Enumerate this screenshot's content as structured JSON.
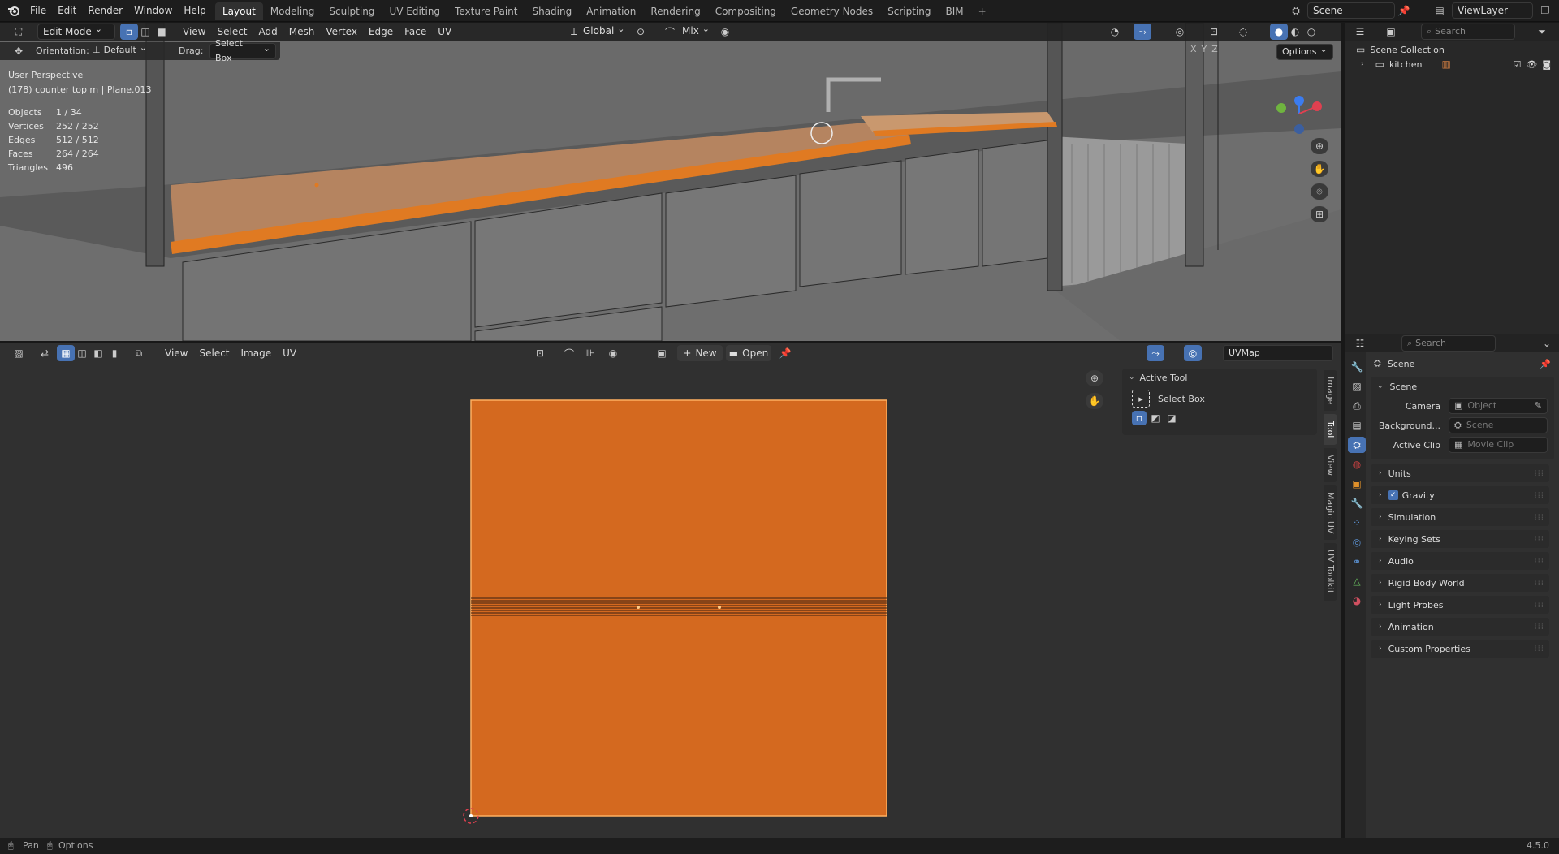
{
  "menu": {
    "file": "File",
    "edit": "Edit",
    "render": "Render",
    "window": "Window",
    "help": "Help"
  },
  "workspaces": [
    "Layout",
    "Modeling",
    "Sculpting",
    "UV Editing",
    "Texture Paint",
    "Shading",
    "Animation",
    "Rendering",
    "Compositing",
    "Geometry Nodes",
    "Scripting",
    "BIM"
  ],
  "active_workspace": "Layout",
  "scene": {
    "name": "Scene",
    "view_layer": "ViewLayer"
  },
  "viewport": {
    "mode": "Edit Mode",
    "menus": [
      "View",
      "Select",
      "Add",
      "Mesh",
      "Vertex",
      "Edge",
      "Face",
      "UV"
    ],
    "transform_orientation": "Global",
    "proportional": "Mix",
    "orientation_label": "Orientation:",
    "orientation_value": "Default",
    "drag_label": "Drag:",
    "drag_value": "Select Box",
    "options": "Options",
    "axes": [
      "X",
      "Y",
      "Z"
    ],
    "view_name": "User Perspective",
    "object_info": "(178) counter top m | Plane.013",
    "stats": [
      {
        "label": "Objects",
        "value": "1 / 34"
      },
      {
        "label": "Vertices",
        "value": "252 / 252"
      },
      {
        "label": "Edges",
        "value": "512 / 512"
      },
      {
        "label": "Faces",
        "value": "264 / 264"
      },
      {
        "label": "Triangles",
        "value": "496"
      }
    ],
    "search_placeholder": "Search"
  },
  "outliner": {
    "search_placeholder": "Search",
    "collection": "Scene Collection",
    "items": [
      "kitchen"
    ]
  },
  "uv_editor": {
    "menus": [
      "View",
      "Select",
      "Image",
      "UV"
    ],
    "new": "New",
    "open": "Open",
    "uvmap": "UVMap",
    "active_tool_title": "Active Tool",
    "active_tool_name": "Select Box",
    "side_tabs": [
      "Image",
      "Tool",
      "View",
      "Magic UV",
      "UV Toolkit"
    ]
  },
  "properties": {
    "search_placeholder": "Search",
    "breadcrumb": "Scene",
    "panel": "Scene",
    "camera_label": "Camera",
    "camera_placeholder": "Object",
    "background_label": "Background...",
    "background_placeholder": "Scene",
    "clip_label": "Active Clip",
    "clip_placeholder": "Movie Clip",
    "sections": [
      "Units",
      "Gravity",
      "Simulation",
      "Keying Sets",
      "Audio",
      "Rigid Body World",
      "Light Probes",
      "Animation",
      "Custom Properties"
    ]
  },
  "status": {
    "pan": "Pan",
    "options": "Options",
    "version": "4.5.0"
  },
  "colors": {
    "accent": "#4772b3",
    "selection": "#e07a22",
    "uv_face": "#d4691f",
    "bg": "#303030"
  }
}
